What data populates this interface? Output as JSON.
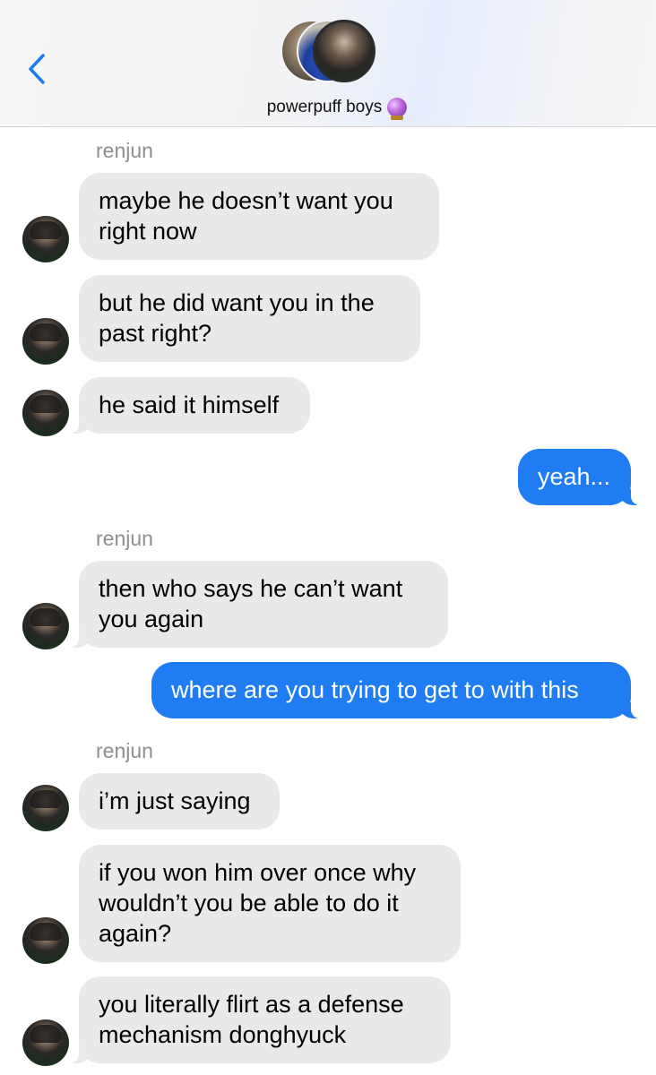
{
  "header": {
    "back_icon": "chevron-left-icon",
    "group_name": "powerpuff boys",
    "group_emoji_icon": "crystal-ball-icon",
    "accent_color": "#1f7cf2"
  },
  "colors": {
    "received_bubble": "#e9e9eb",
    "sent_bubble": "#1f7cf2",
    "sender_label": "#8e8e93"
  },
  "messages": [
    {
      "sender": "renjun"
    },
    {
      "text_lines": [
        "maybe he doesn’t want you",
        "right now"
      ]
    },
    {
      "text_lines": [
        "but he did want you in the",
        "past right?"
      ]
    },
    {
      "text_lines": [
        "he said it himself"
      ]
    },
    {
      "text_lines": [
        "yeah..."
      ]
    },
    {
      "sender": "renjun"
    },
    {
      "text_lines": [
        "then who says he can’t want",
        "you again"
      ]
    },
    {
      "text_lines": [
        "where are you trying to get to with this"
      ]
    },
    {
      "sender": "renjun"
    },
    {
      "text_lines": [
        "i’m just saying"
      ]
    },
    {
      "text_lines": [
        "if you won him over once why",
        "wouldn’t you be able to do it",
        "again?"
      ]
    },
    {
      "text_lines": [
        "you literally flirt as a defense",
        "mechanism donghyuck"
      ]
    }
  ]
}
